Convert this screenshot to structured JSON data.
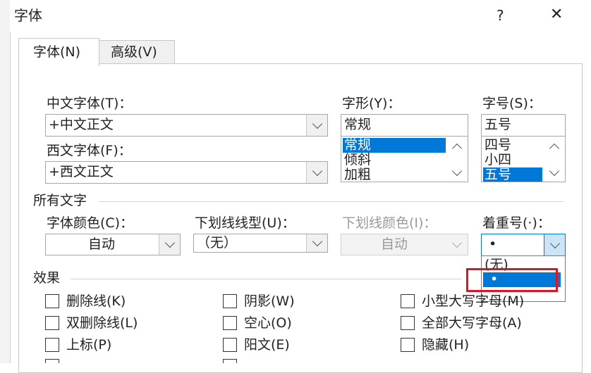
{
  "window": {
    "title": "字体",
    "help": "?",
    "close": "✕"
  },
  "tabs": [
    {
      "label": "字体(N)",
      "active": true
    },
    {
      "label": "高级(V)",
      "active": false
    }
  ],
  "chinese_font": {
    "label": "中文字体(T)：",
    "value": "+中文正文"
  },
  "western_font": {
    "label": "西文字体(F)：",
    "value": "+西文正文"
  },
  "font_style": {
    "label": "字形(Y)：",
    "value": "常规",
    "options": [
      "常规",
      "倾斜",
      "加粗"
    ],
    "selected": "常规"
  },
  "font_size": {
    "label": "字号(S)：",
    "value": "五号",
    "options": [
      "四号",
      "小四",
      "五号"
    ],
    "selected": "五号"
  },
  "all_text": {
    "heading": "所有文字"
  },
  "font_color": {
    "label": "字体颜色(C)：",
    "value": "自动"
  },
  "underline_style": {
    "label": "下划线线型(U)：",
    "value": "（无）"
  },
  "underline_color": {
    "label": "下划线颜色(I)：",
    "value": "自动",
    "disabled": true
  },
  "emphasis": {
    "label": "着重号(·)：",
    "value": "•",
    "dropdown_options": [
      "(无)",
      "•"
    ],
    "highlighted": "•"
  },
  "effects": {
    "heading": "效果",
    "items": [
      {
        "label": "删除线(K)"
      },
      {
        "label": "阴影(W)"
      },
      {
        "label": "小型大写字母(M)"
      },
      {
        "label": "双删除线(L)"
      },
      {
        "label": "空心(O)"
      },
      {
        "label": "全部大写字母(A)"
      },
      {
        "label": "上标(P)"
      },
      {
        "label": "阳文(E)"
      },
      {
        "label": "隐藏(H)"
      }
    ]
  },
  "colors": {
    "selection": "#0078d7",
    "highlight_box": "#e0141e",
    "disabled_text": "#9a9a9a"
  }
}
